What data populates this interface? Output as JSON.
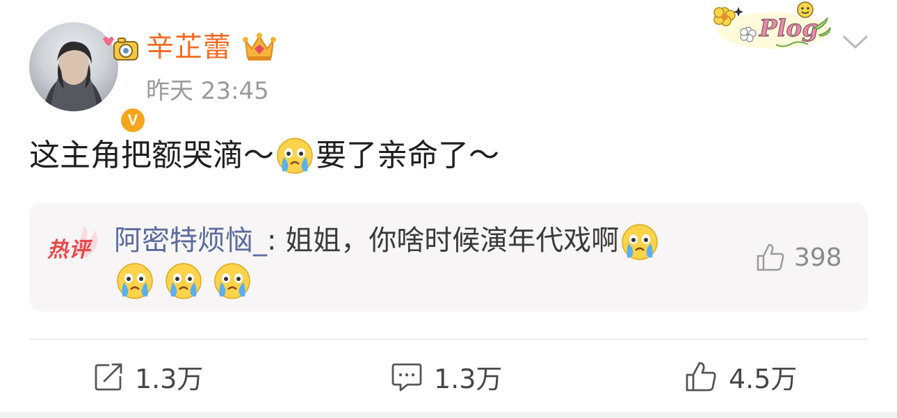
{
  "post": {
    "author": {
      "name": "辛芷蕾",
      "verified_badge": "V",
      "avatar_icon": "user-avatar",
      "crown_icon": "crown-icon"
    },
    "timestamp": "昨天 23:45",
    "sticker_text": "Plog",
    "text_before_emoji": "这主角把额哭滴～",
    "text_after_emoji": "要了亲命了～"
  },
  "hot_comment": {
    "badge": "热评",
    "user": "阿密特烦恼_",
    "separator": ":",
    "text": " 姐姐，你啥时候演年代戏啊",
    "emoji_name": "crying-face-emoji",
    "like_count": "398"
  },
  "actions": {
    "repost_count": "1.3万",
    "comment_count": "1.3万",
    "like_count": "4.5万"
  },
  "colors": {
    "username": "#f26a22",
    "timestamp": "#9a9a9a",
    "comment_user": "#5a6b9c",
    "hot_badge": "#e8474a",
    "comment_bg": "#f7f5f5",
    "verified": "#f7a51c"
  }
}
